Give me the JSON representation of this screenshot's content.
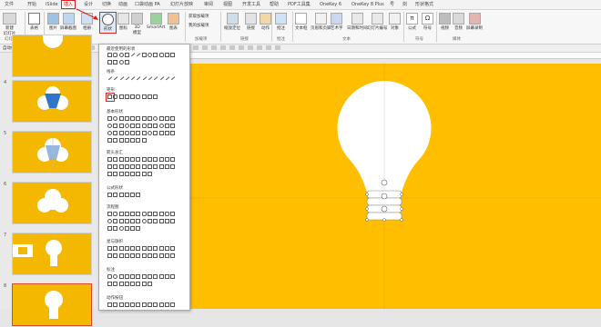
{
  "tabs": [
    "文件",
    "开始",
    "iSlide",
    "插入",
    "设计",
    "切换",
    "动画",
    "口袋动画 PA",
    "幻灯片放映",
    "审阅",
    "视图",
    "开发工具",
    "帮助",
    "PDF工具集",
    "OneKey 6",
    "OneKey 8 Plus",
    "号",
    "剑",
    "形状格式"
  ],
  "active_tab": "插入",
  "ribbon": {
    "new_slide": "新建\n幻灯片",
    "table": "表格",
    "image": "图片",
    "screenshot": "屏幕截图",
    "album": "相册",
    "shapes": "形状",
    "icons": "图标",
    "model3d": "3D\n模型",
    "smartart": "SmartArt",
    "chart": "图表",
    "get_addins": "获取加载项",
    "my_addins": "我的加载项",
    "zoom": "缩放定位",
    "link": "链接",
    "action": "动作",
    "comment": "批注",
    "textbox": "文本框",
    "header_footer": "页眉和页脚",
    "wordart": "艺术字",
    "datetime": "日期和时间",
    "slide_number": "幻灯片编号",
    "object": "对象",
    "equation": "公式",
    "symbol": "符号",
    "video": "视频",
    "audio": "音频",
    "screen_record": "屏幕录制",
    "groups": {
      "slides": "幻灯片",
      "tables": "表格",
      "images": "图像",
      "addins": "加载项",
      "links": "链接",
      "comments": "批注",
      "text": "文本",
      "symbols": "符号",
      "media": "媒体"
    }
  },
  "toolbar2": {
    "label": "自动保存"
  },
  "thumbnails": [
    "4",
    "5",
    "6",
    "7",
    "8"
  ],
  "shapes_menu": {
    "recent": "最近使用的形状",
    "lines": "线条",
    "rectangles": "矩形",
    "basic": "基本形状",
    "arrows": "箭头总汇",
    "equation": "公式形状",
    "flowchart": "流程图",
    "stars": "星与旗帜",
    "callouts": "标注",
    "action_buttons": "动作按钮"
  },
  "colors": {
    "slide_bg": "#ffbf00",
    "accent_red": "#e02020",
    "bulb_blue": "#2f75c8"
  }
}
